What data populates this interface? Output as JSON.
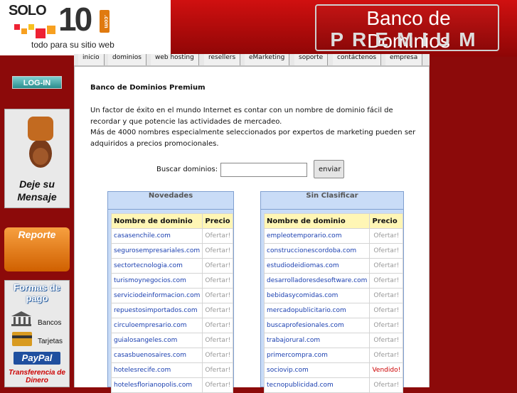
{
  "logo": {
    "solo": "SOLO",
    "ten": "10",
    "com": ".com",
    "tagline": "todo para su sitio web"
  },
  "banner": {
    "title": "Banco de Dominios",
    "subtitle": "PREMIUM"
  },
  "nav": [
    "inicio",
    "dominios",
    "web hosting",
    "resellers",
    "eMarketing",
    "soporte",
    "contáctenos",
    "empresa"
  ],
  "sidebar": {
    "login": "LOG-IN",
    "mensaje": "Deje su Mensaje",
    "reporte": "Reporte",
    "pago_title": "Formas de pago",
    "bancos": "Bancos",
    "tarjetas": "Tarjetas",
    "paypal": "PayPal",
    "transferencia": "Transferencia de Dinero"
  },
  "content": {
    "title": "Banco de Dominios Premium",
    "desc1": "Un factor de éxito en el mundo Internet es contar con un nombre de dominio fácil de recordar y que potencie las actividades de mercadeo.",
    "desc2": "Más de 4000 nombres especialmente seleccionados por expertos de marketing pueden ser adquiridos a precios promocionales.",
    "search_label": "Buscar dominios:",
    "search_value": "",
    "search_button": "enviar"
  },
  "panels": [
    {
      "title": "Novedades",
      "col_name": "Nombre de dominio",
      "col_price": "Precio",
      "rows": [
        {
          "name": "casasenchile.com",
          "price": "Ofertar!"
        },
        {
          "name": "segurosempresariales.com",
          "price": "Ofertar!"
        },
        {
          "name": "sectortecnologia.com",
          "price": "Ofertar!"
        },
        {
          "name": "turismoynegocios.com",
          "price": "Ofertar!"
        },
        {
          "name": "serviciodeinformacion.com",
          "price": "Ofertar!"
        },
        {
          "name": "repuestosimportados.com",
          "price": "Ofertar!"
        },
        {
          "name": "circuloempresario.com",
          "price": "Ofertar!"
        },
        {
          "name": "guialosangeles.com",
          "price": "Ofertar!"
        },
        {
          "name": "casasbuenosaires.com",
          "price": "Ofertar!"
        },
        {
          "name": "hotelesrecife.com",
          "price": "Ofertar!"
        },
        {
          "name": "hotelesflorianopolis.com",
          "price": "Ofertar!"
        }
      ]
    },
    {
      "title": "Sin Clasificar",
      "col_name": "Nombre de dominio",
      "col_price": "Precio",
      "rows": [
        {
          "name": "empleotemporario.com",
          "price": "Ofertar!"
        },
        {
          "name": "construccionescordoba.com",
          "price": "Ofertar!"
        },
        {
          "name": "estudiodeidiomas.com",
          "price": "Ofertar!"
        },
        {
          "name": "desarrolladoresdesoftware.com",
          "price": "Ofertar!"
        },
        {
          "name": "bebidasycomidas.com",
          "price": "Ofertar!"
        },
        {
          "name": "mercadopublicitario.com",
          "price": "Ofertar!"
        },
        {
          "name": "buscaprofesionales.com",
          "price": "Ofertar!"
        },
        {
          "name": "trabajorural.com",
          "price": "Ofertar!"
        },
        {
          "name": "primercompra.com",
          "price": "Ofertar!"
        },
        {
          "name": "sociovip.com",
          "price": "Vendido!",
          "sold": true
        },
        {
          "name": "tecnopublicidad.com",
          "price": "Ofertar!"
        }
      ]
    }
  ]
}
